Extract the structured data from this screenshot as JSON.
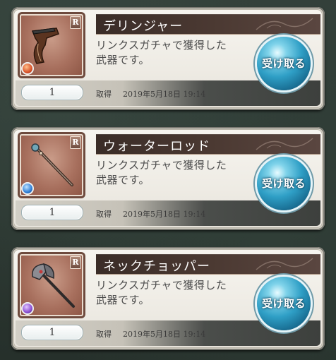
{
  "items": [
    {
      "name": "デリンジャー",
      "description_line1": "リンクスガチャで獲得した",
      "description_line2": "武器です。",
      "quantity": "1",
      "acquired_label": "取得",
      "acquired_date": "2019年5月18日 19:14",
      "rarity": "R",
      "element_icon": "fire-element-icon",
      "element_color": "#d9532a",
      "receive_label": "受け取る"
    },
    {
      "name": "ウォーターロッド",
      "description_line1": "リンクスガチャで獲得した",
      "description_line2": "武器です。",
      "quantity": "1",
      "acquired_label": "取得",
      "acquired_date": "2019年5月18日 19:14",
      "rarity": "R",
      "element_icon": "water-element-icon",
      "element_color": "#2f7fd6",
      "receive_label": "受け取る"
    },
    {
      "name": "ネックチョッパー",
      "description_line1": "リンクスガチャで獲得した",
      "description_line2": "武器です。",
      "quantity": "1",
      "acquired_label": "取得",
      "acquired_date": "2019年5月18日 19:14",
      "rarity": "R",
      "element_icon": "dark-element-icon",
      "element_color": "#8a4fd1",
      "receive_label": "受け取る"
    }
  ]
}
